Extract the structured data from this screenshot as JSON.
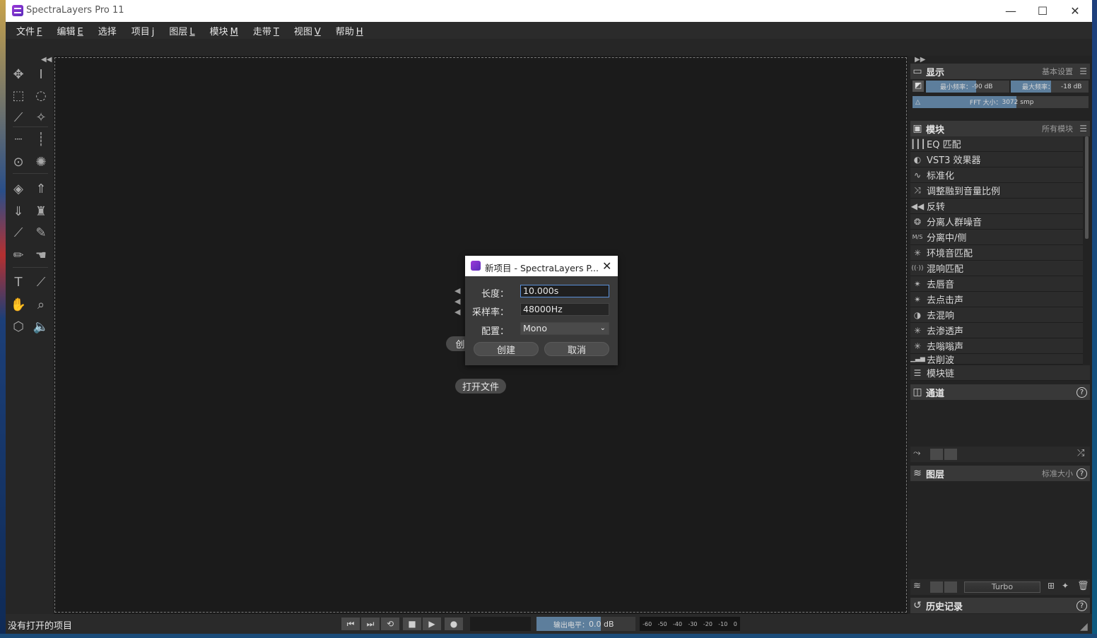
{
  "window": {
    "title": "SpectraLayers Pro 11",
    "controls": {
      "minimize": "—",
      "maximize": "☐",
      "close": "✕"
    }
  },
  "menu": [
    {
      "label": "文件",
      "key": "F"
    },
    {
      "label": "编辑",
      "key": "E"
    },
    {
      "label": "选择",
      "key": ""
    },
    {
      "label": "项目",
      "key": "j"
    },
    {
      "label": "图层",
      "key": "L"
    },
    {
      "label": "模块",
      "key": "M"
    },
    {
      "label": "走带",
      "key": "T"
    },
    {
      "label": "视图",
      "key": "V"
    },
    {
      "label": "帮助",
      "key": "H"
    }
  ],
  "welcome": {
    "create_button": "创",
    "open_file_button": "打开文件"
  },
  "dialog": {
    "title": "新项目 - SpectraLayers P...",
    "length_label": "长度：",
    "length_value": "10.000s",
    "samplerate_label": "采样率：",
    "samplerate_value": "48000Hz",
    "config_label": "配置：",
    "config_value": "Mono",
    "create_button": "创建",
    "cancel_button": "取消"
  },
  "panels": {
    "display": {
      "title": "显示",
      "preset": "基本设置",
      "min_freq_label": "最小频率：",
      "min_freq_value": "-90 dB",
      "max_freq_label": "最大频率：",
      "max_freq_value": "-18 dB",
      "fft_label": "FFT 大小：",
      "fft_value": "3072 smp"
    },
    "modules": {
      "title": "模块",
      "filter": "所有模块",
      "items": [
        {
          "icon": "┃┃┃",
          "label": "EQ 匹配"
        },
        {
          "icon": "◐",
          "label": "VST3 效果器"
        },
        {
          "icon": "∿",
          "label": "标准化"
        },
        {
          "icon": "⤨",
          "label": "调整融到音量比例"
        },
        {
          "icon": "◀◀",
          "label": "反转"
        },
        {
          "icon": "❂",
          "label": "分离人群噪音"
        },
        {
          "icon": "M/S",
          "label": "分离中/侧"
        },
        {
          "icon": "✳",
          "label": "环境音匹配"
        },
        {
          "icon": "((·))",
          "label": "混响匹配"
        },
        {
          "icon": "✴",
          "label": "去唇音"
        },
        {
          "icon": "✴",
          "label": "去点击声"
        },
        {
          "icon": "◑",
          "label": "去混响"
        },
        {
          "icon": "✳",
          "label": "去渗透声"
        },
        {
          "icon": "✳",
          "label": "去嗡嗡声"
        },
        {
          "icon": "▁▃▅",
          "label": "去削波"
        }
      ],
      "chain_label": "模块链"
    },
    "channels": {
      "title": "通道"
    },
    "layers": {
      "title": "图层",
      "size": "标准大小",
      "mode": "Turbo"
    },
    "history": {
      "title": "历史记录"
    }
  },
  "status": {
    "text": "没有打开的项目",
    "output_level_label": "输出电平：",
    "output_level_value": "0.0 dB",
    "meter_ticks": [
      "-60",
      "-50",
      "-40",
      "-30",
      "-20",
      "-10",
      "0"
    ]
  }
}
